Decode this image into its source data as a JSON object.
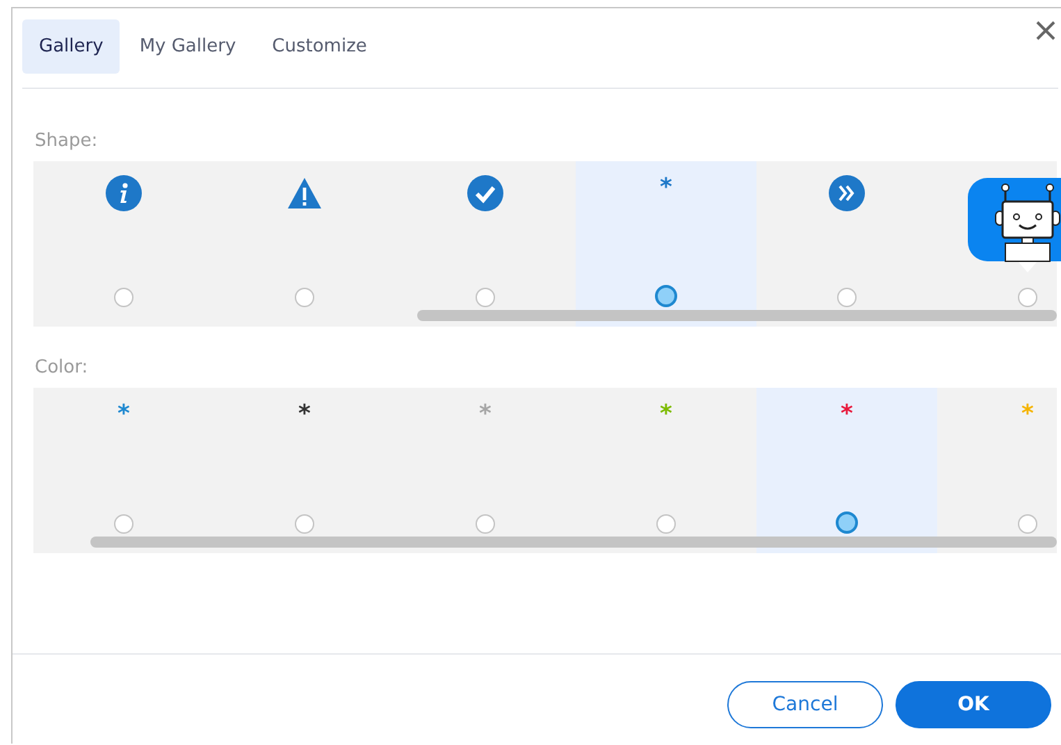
{
  "tabs": [
    {
      "label": "Gallery",
      "selected": true
    },
    {
      "label": "My Gallery",
      "selected": false
    },
    {
      "label": "Customize",
      "selected": false
    }
  ],
  "shape": {
    "label": "Shape:",
    "items": [
      {
        "kind": "info",
        "selected": false
      },
      {
        "kind": "warning",
        "selected": false
      },
      {
        "kind": "check",
        "selected": false
      },
      {
        "kind": "symbol",
        "symbol": "*",
        "selected": true
      },
      {
        "kind": "forward",
        "selected": false
      },
      {
        "kind": "robot",
        "selected": false
      }
    ]
  },
  "color": {
    "label": "Color:",
    "items": [
      {
        "symbol": "*",
        "color": "#1e88d0",
        "selected": false
      },
      {
        "symbol": "*",
        "color": "#333333",
        "selected": false
      },
      {
        "symbol": "*",
        "color": "#a6a6a6",
        "selected": false
      },
      {
        "symbol": "*",
        "color": "#7cbb00",
        "selected": false
      },
      {
        "symbol": "*",
        "color": "#e8193c",
        "selected": true
      },
      {
        "symbol": "*",
        "color": "#f5b400",
        "selected": false
      }
    ]
  },
  "buttons": [
    {
      "label": "Cancel",
      "kind": "secondary"
    },
    {
      "label": "OK",
      "kind": "primary"
    }
  ]
}
